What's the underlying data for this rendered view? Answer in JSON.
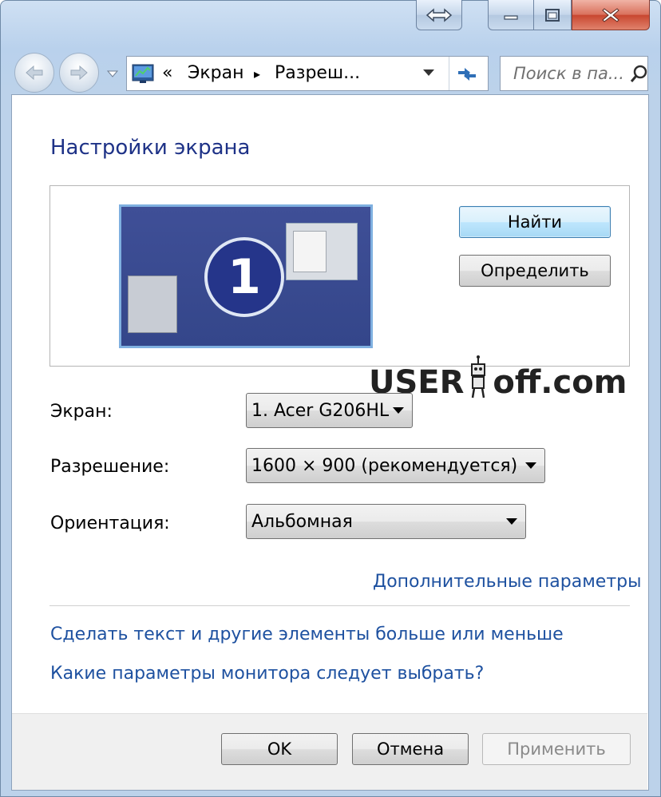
{
  "address_bar": {
    "chevron": "«",
    "crumbs": [
      "Экран",
      "Разреш..."
    ],
    "crumb_separator": "▸"
  },
  "search": {
    "placeholder": "Поиск в па..."
  },
  "page": {
    "title": "Настройки экрана"
  },
  "preview": {
    "monitor_number": "1"
  },
  "buttons": {
    "find": "Найти",
    "identify": "Определить",
    "ok": "OK",
    "cancel": "Отмена",
    "apply": "Применить"
  },
  "watermark": {
    "left": "USER",
    "right": "off.com"
  },
  "fields": {
    "screen": {
      "label": "Экран:",
      "value": "1. Acer G206HL"
    },
    "resolution": {
      "label": "Разрешение:",
      "value": "1600 × 900 (рекомендуется)"
    },
    "orientation": {
      "label": "Ориентация:",
      "value": "Альбомная"
    }
  },
  "links": {
    "advanced": "Дополнительные параметры",
    "text_size": "Сделать текст и другие элементы больше или меньше",
    "which_settings": "Какие параметры монитора следует выбрать?"
  },
  "icons": {
    "snap": "resize-horizontal-icon",
    "minimize": "minimize-icon",
    "maximize": "maximize-icon",
    "close": "close-icon",
    "back": "back-arrow-icon",
    "forward": "forward-arrow-icon",
    "location": "control-panel-icon",
    "refresh": "refresh-icon",
    "search": "search-icon"
  },
  "colors": {
    "title": "#1e3287",
    "link": "#1e51a0",
    "monitor_bg": "#3f4f97",
    "close_button": "#c8462f"
  }
}
